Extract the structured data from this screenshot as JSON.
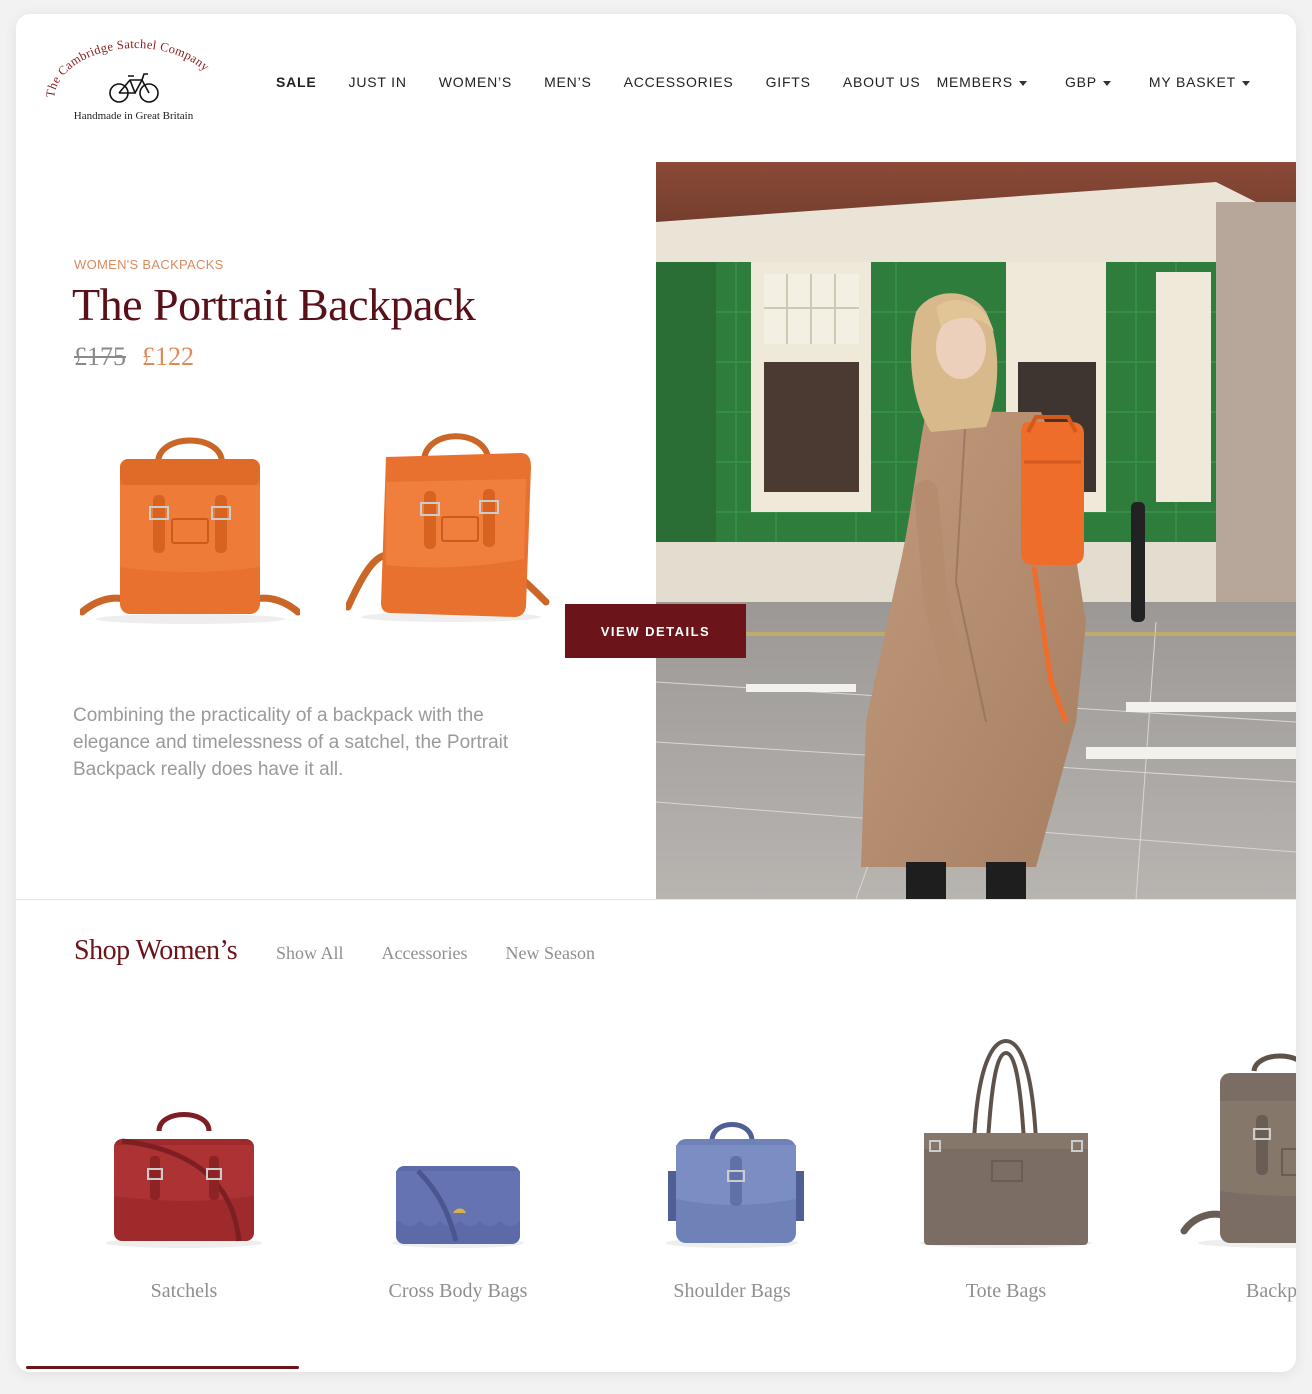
{
  "brand": {
    "name": "The Cambridge Satchel Company",
    "tagline": "Handmade in Great Britain",
    "color": "#8b1a1a"
  },
  "nav": {
    "items": [
      {
        "label": "SALE"
      },
      {
        "label": "JUST IN"
      },
      {
        "label": "WOMEN’S"
      },
      {
        "label": "MEN’S"
      },
      {
        "label": "ACCESSORIES"
      },
      {
        "label": "GIFTS"
      },
      {
        "label": "ABOUT US"
      }
    ],
    "members": "MEMBERS",
    "currency": "GBP",
    "basket": "MY BASKET"
  },
  "hero": {
    "eyebrow": "WOMEN'S BACKPACKS",
    "title": "The Portrait Backpack",
    "price_old": "£175",
    "price_new": "£122",
    "description": "Combining the practicality of a backpack with the elegance and timelessness of a satchel, the Portrait Backpack really does have it all.",
    "cta": "VIEW DETAILS",
    "product_color": "#e8712f"
  },
  "shop": {
    "title": "Shop Women’s",
    "tabs": [
      "Show All",
      "Accessories",
      "New Season"
    ],
    "categories": [
      {
        "label": "Satchels",
        "color": "#9e2a2b"
      },
      {
        "label": "Cross Body Bags",
        "color": "#5d6aa8"
      },
      {
        "label": "Shoulder Bags",
        "color": "#6f82b8"
      },
      {
        "label": "Tote Bags",
        "color": "#7b6d63"
      },
      {
        "label": "Backpa",
        "color": "#7b6d63"
      }
    ],
    "scroll_progress": 0.22
  },
  "colors": {
    "accent": "#6b1419",
    "price_accent": "#e08a5a",
    "muted_text": "#8f8f8f"
  }
}
